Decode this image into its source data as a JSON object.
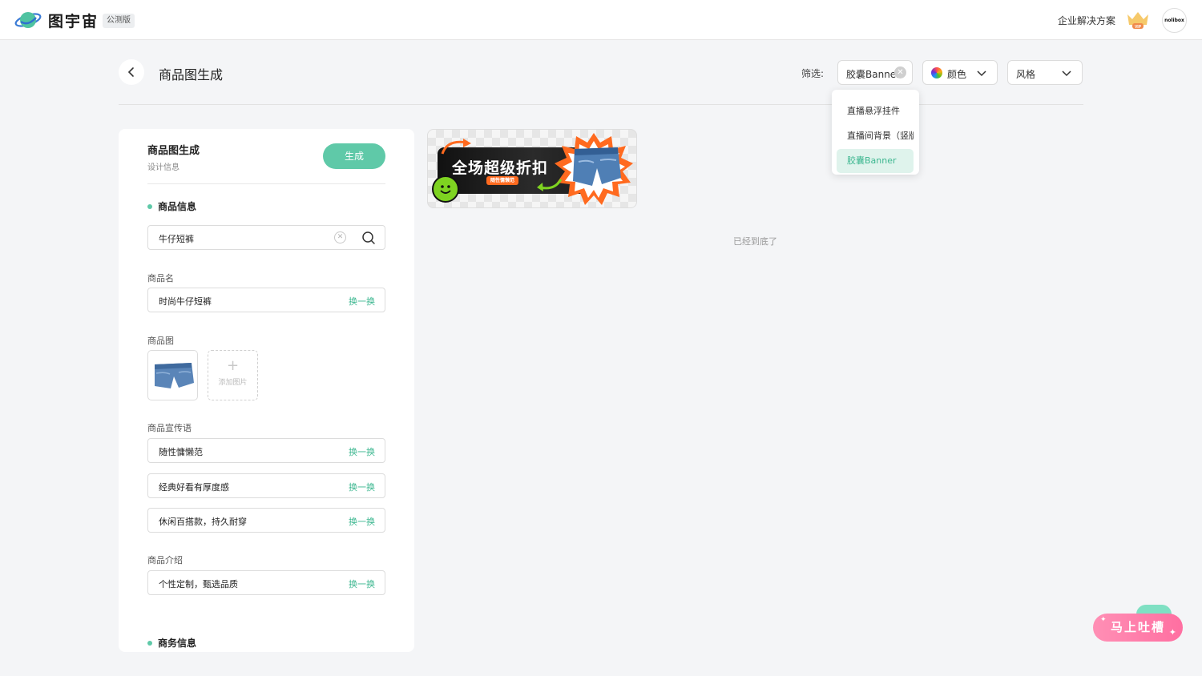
{
  "header": {
    "brand": "图宇宙",
    "badge": "公测版",
    "enterprise_link": "企业解决方案",
    "vip_label": "VIP",
    "avatar_text": "nolibox"
  },
  "page": {
    "title": "商品图生成",
    "filter_label": "筛选:",
    "filters": {
      "banner_chip": "胶囊Banner",
      "color_chip": "颜色",
      "style_chip": "风格"
    },
    "dropdown": {
      "items": [
        "直播悬浮挂件",
        "直播间背景（竖版）",
        "胶囊Banner"
      ],
      "selected": "胶囊Banner"
    }
  },
  "panel": {
    "title": "商品图生成",
    "subtitle": "设计信息",
    "generate_button": "生成",
    "product_section": "商品信息",
    "search_value": "牛仔短裤",
    "name_label": "商品名",
    "name_value": "时尚牛仔短裤",
    "swap_label": "换一换",
    "image_label": "商品图",
    "add_image_label": "添加图片",
    "slogan_label": "商品宣传语",
    "slogans": [
      "随性慵懒范",
      "经典好看有厚度感",
      "休闲百搭款，持久耐穿"
    ],
    "intro_label": "商品介绍",
    "intro_value": "个性定制，甄选品质",
    "business_section": "商务信息"
  },
  "result": {
    "banner_headline": "全场超级折扣",
    "banner_tag": "随性慵懒范",
    "end_text": "已经到底了"
  },
  "feedback": {
    "label": "马上吐槽"
  },
  "colors": {
    "accent": "#5fc9a8",
    "accent_text": "#3db790",
    "feedback": "#ff7aa8",
    "banner_orange": "#ff6a1f"
  }
}
